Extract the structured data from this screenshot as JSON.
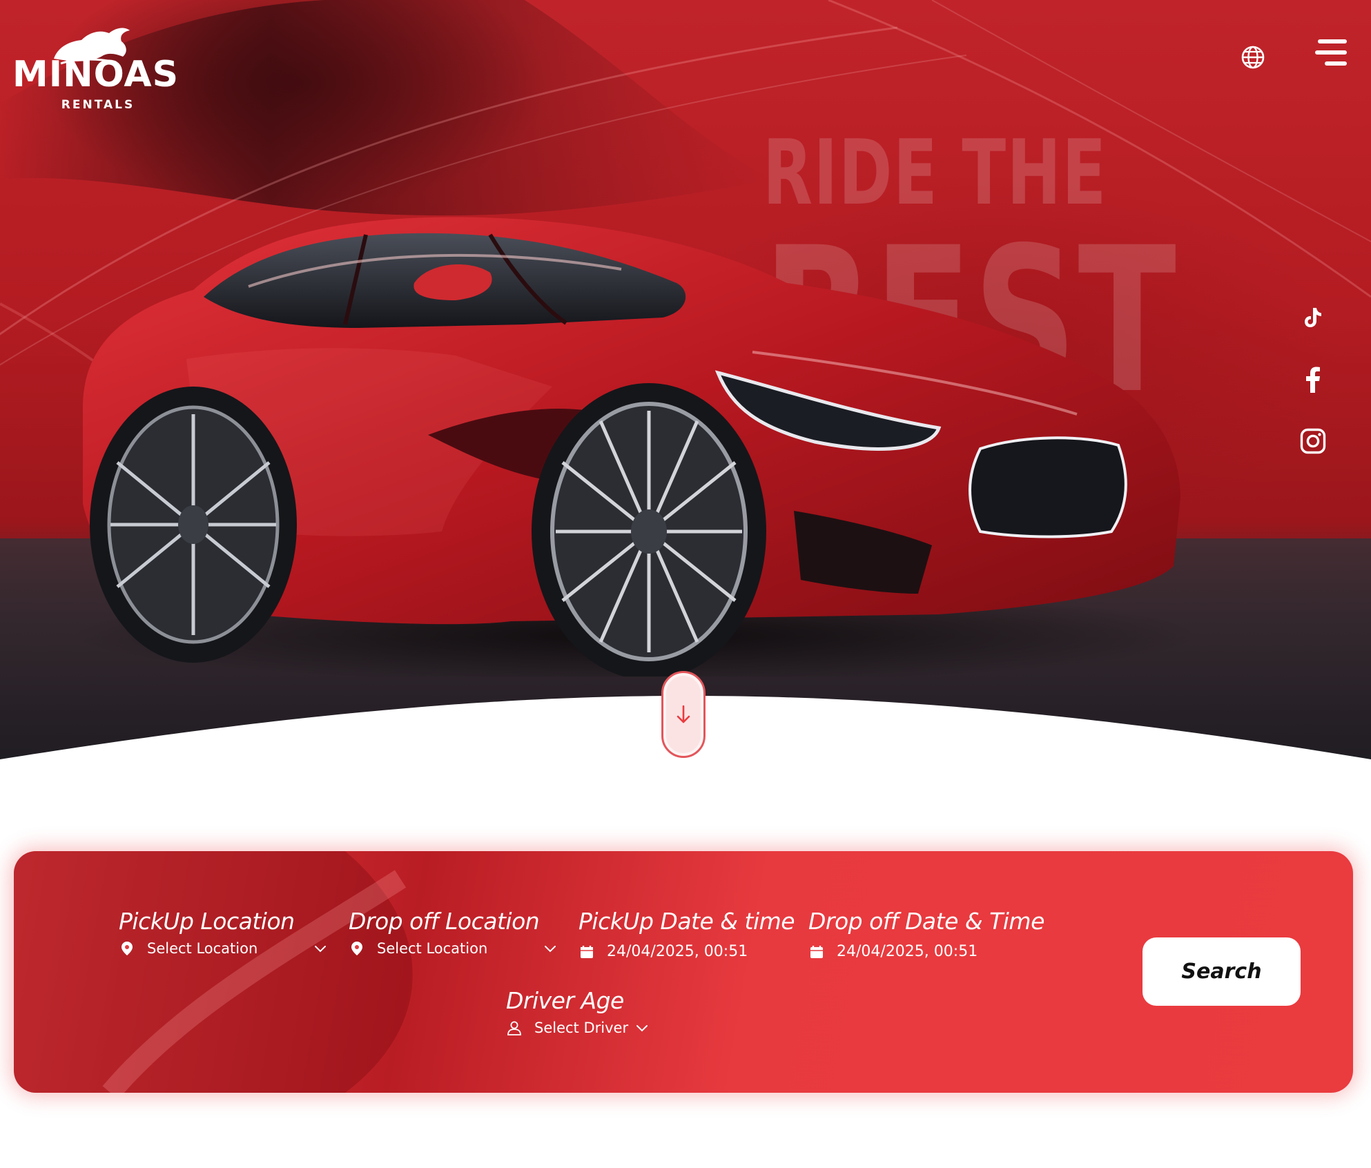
{
  "brand": {
    "name": "MINOAS",
    "tagline": "RENTALS"
  },
  "hero": {
    "headline_line1": "RIDE THE",
    "headline_line2": "BEST"
  },
  "icons": {
    "language": "globe-icon",
    "menu": "hamburger-menu-icon",
    "scroll": "arrow-down-icon",
    "social": [
      "tiktok-icon",
      "facebook-icon",
      "instagram-icon"
    ]
  },
  "colors": {
    "accent": "#ea3b3f",
    "accent_dark": "#b91d24",
    "white": "#ffffff"
  },
  "search": {
    "pickup_location": {
      "label": "PickUp Location",
      "value": "Select Location"
    },
    "dropoff_location": {
      "label": "Drop off Location",
      "value": "Select Location"
    },
    "pickup_datetime": {
      "label": "PickUp Date & time",
      "value": "24/04/2025, 00:51"
    },
    "dropoff_datetime": {
      "label": "Drop off Date & Time",
      "value": "24/04/2025, 00:51"
    },
    "driver_age": {
      "label": "Driver Age",
      "value": "Select Driver"
    },
    "button_label": "Search"
  }
}
